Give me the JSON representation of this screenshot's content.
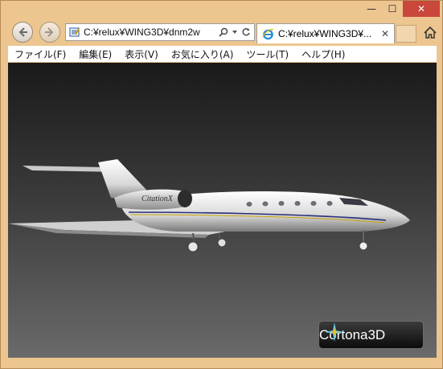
{
  "window": {
    "minimize_symbol": "—",
    "maximize_symbol": "☐",
    "close_symbol": "✕"
  },
  "nav": {
    "address_url": "C:¥relux¥WING3D¥dnm2w",
    "back_icon": "back-arrow-icon",
    "forward_icon": "forward-arrow-icon"
  },
  "tab": {
    "title": "C:¥relux¥WING3D¥...",
    "close_symbol": "✕"
  },
  "menu": {
    "items": [
      "ファイル(F)",
      "編集(E)",
      "表示(V)",
      "お気に入り(A)",
      "ツール(T)",
      "ヘルプ(H)"
    ]
  },
  "viewer": {
    "aircraft_label": "CitationX",
    "brand": "Cortona3D"
  },
  "colors": {
    "close_button": "#c9473b",
    "frame": "#ecc58f"
  }
}
